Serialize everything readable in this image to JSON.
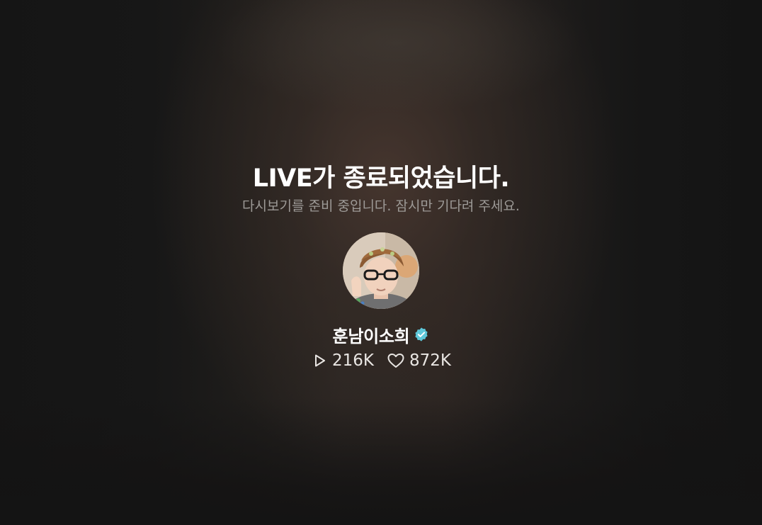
{
  "live": {
    "title": "LIVE가 종료되었습니다.",
    "subtitle": "다시보기를 준비 중입니다. 잠시만 기다려 주세요."
  },
  "channel": {
    "name": "훈남이소희",
    "verified": true,
    "badge_color": "#5ec7d9"
  },
  "stats": {
    "views": "216K",
    "likes": "872K"
  }
}
